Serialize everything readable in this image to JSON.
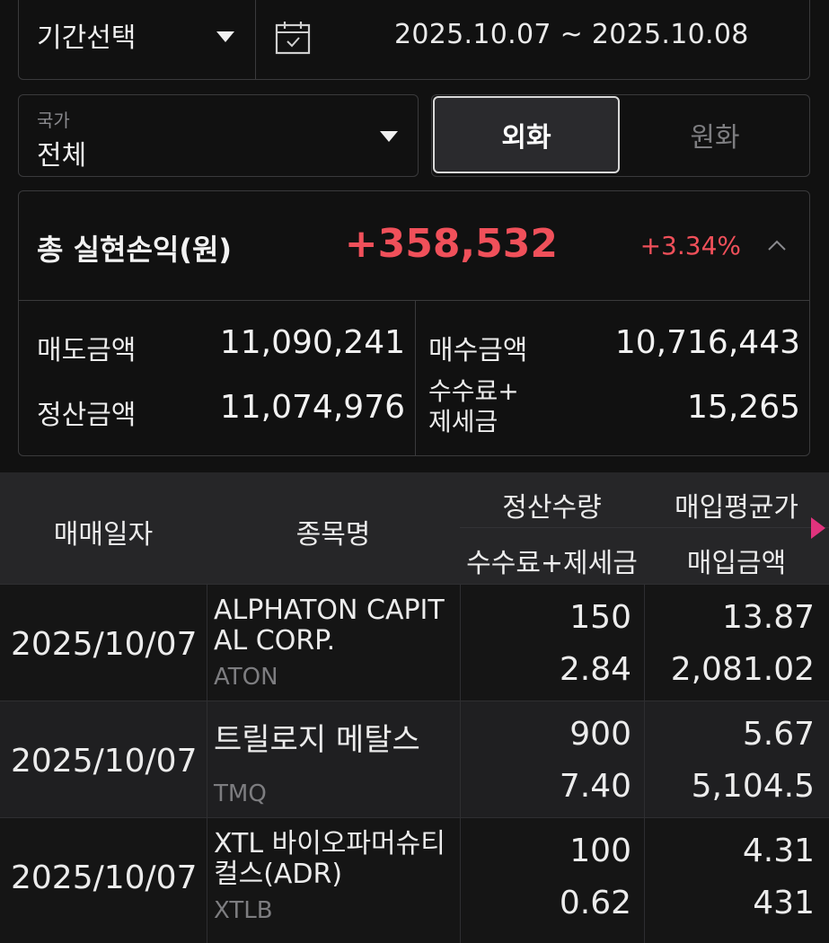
{
  "period": {
    "label": "기간선택",
    "date_range": "2025.10.07 ~ 2025.10.08"
  },
  "country": {
    "label": "국가",
    "value": "전체"
  },
  "currency_toggle": {
    "options": [
      "외화",
      "원화"
    ],
    "selected": "외화"
  },
  "summary": {
    "title": "총 실현손익(원)",
    "amount": "+358,532",
    "rate": "+3.34%",
    "sell_label": "매도금액",
    "sell_value": "11,090,241",
    "buy_label": "매수금액",
    "buy_value": "10,716,443",
    "settle_label": "정산금액",
    "settle_value": "11,074,976",
    "fee_label_line1": "수수료+",
    "fee_label_line2": "제세금",
    "fee_value": "15,265"
  },
  "table": {
    "headers": {
      "date": "매매일자",
      "name": "종목명",
      "qty": "정산수량",
      "fee": "수수료+제세금",
      "avg_price": "매입평균가",
      "amount": "매입금액"
    },
    "rows": [
      {
        "date": "2025/10/07",
        "name_line1": "ALPHATON CAPIT",
        "name_line2": "AL CORP.",
        "ticker": "ATON",
        "qty": "150",
        "fee": "2.84",
        "avg_price": "13.87",
        "amount": "2,081.02"
      },
      {
        "date": "2025/10/07",
        "name_line1": "트릴로지 메탈스",
        "name_line2": "",
        "ticker": "TMQ",
        "qty": "900",
        "fee": "7.40",
        "avg_price": "5.67",
        "amount": "5,104.5"
      },
      {
        "date": "2025/10/07",
        "name_line1": "XTL 바이오파머슈티",
        "name_line2": "컬스(ADR)",
        "ticker": "XTLB",
        "qty": "100",
        "fee": "0.62",
        "avg_price": "4.31",
        "amount": "431"
      }
    ]
  },
  "colors": {
    "background": "#111111",
    "profit_red": "#f0505a",
    "scroll_indicator": "#e0337d"
  }
}
